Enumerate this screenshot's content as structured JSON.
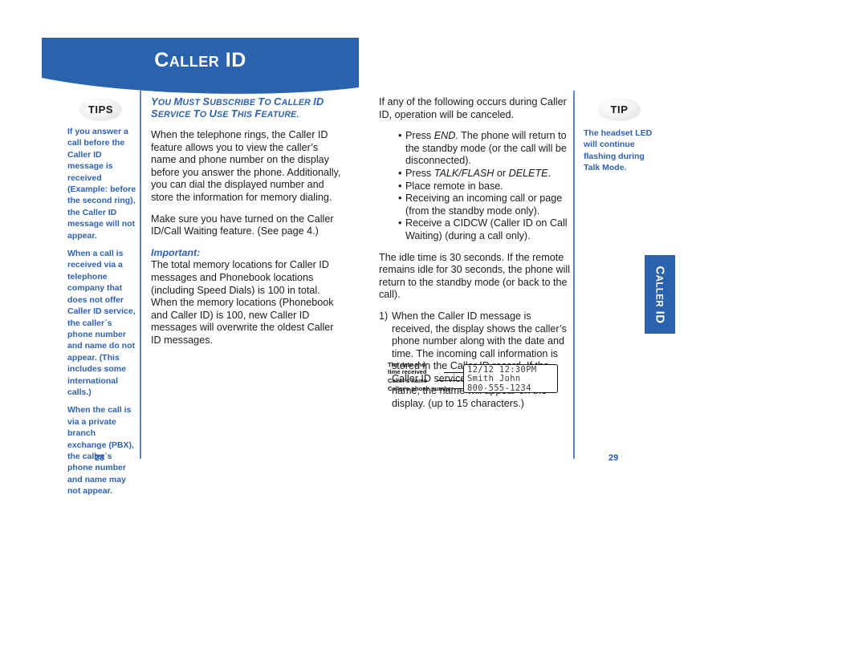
{
  "document": {
    "banner_title": "Caller ID",
    "banner_title_caps": "C",
    "side_tab_text": "Caller ID",
    "accent_blue": "#2a62ae",
    "tip_blue_text": "#2e62b0",
    "divider_blue": "#5b86c9"
  },
  "left_page": {
    "page_number": "28",
    "tips_badge": "TIPS",
    "tips_paragraphs": [
      "If you answer a call before the Caller ID message is received (Example: before the second ring), the Caller ID message will not appear.",
      "When a call is received via a telephone company that does not offer Caller ID service, the caller´s phone number and name do not appear. (This includes some international calls.)",
      "When the call is via a private branch exchange (PBX), the caller´s phone number and name may not appear."
    ],
    "subscribe_notice": "You must subscribe to Caller ID service to use this feature.",
    "paragraph_intro": "When the telephone rings, the Caller ID feature allows you to view the caller’s name and phone number on the display before you answer the phone. Additionally, you can dial the displayed number and store the information for memory dialing.",
    "paragraph_callwaiting": "Make sure you have turned on the Caller ID/Call Waiting feature. (See page 4.)",
    "important_label": "Important:",
    "paragraph_important": "The total memory locations for Caller ID messages and Phonebook locations (including Speed Dials) is 100 in total. When the memory locations (Phonebook and Caller ID) is 100, new Caller ID messages will overwrite the oldest Caller ID messages."
  },
  "right_page": {
    "page_number": "29",
    "tip_badge": "TIP",
    "tip_paragraph": "The headset LED will continue flashing during Talk Mode.",
    "paragraph_cancel_intro": "If any of the following occurs during Caller ID, operation will be canceled.",
    "cancel_bullets": [
      "Press END. The phone will return to the standby mode (or the call will be disconnected).",
      "Press TALK/FLASH or DELETE.",
      "Place remote in base.",
      "Receiving an incoming call or page (from the standby mode only).",
      "Receive a CIDCW (Caller ID on Call Waiting) (during a call only)."
    ],
    "paragraph_idle": "The idle time is 30 seconds. If the remote remains idle for 30 seconds, the phone will return to the standby mode (or back to the call).",
    "numbered_item_number": "1)",
    "numbered_item_text": "When the Caller ID message is received, the display shows the caller’s phone number along with the date and time. The incoming call information is stored in the Caller ID record. If the Caller ID service includes the caller’s name, the name will appear on the display. (up to 15 characters.)",
    "lcd_figure": {
      "label_date": "The date and\ntime received",
      "label_name": "Caller's name",
      "label_number": "Caller's phone number",
      "screen_line_1": "12/12 12:30PM",
      "screen_line_2": "Smith John",
      "screen_line_3": "800-555-1234"
    }
  }
}
